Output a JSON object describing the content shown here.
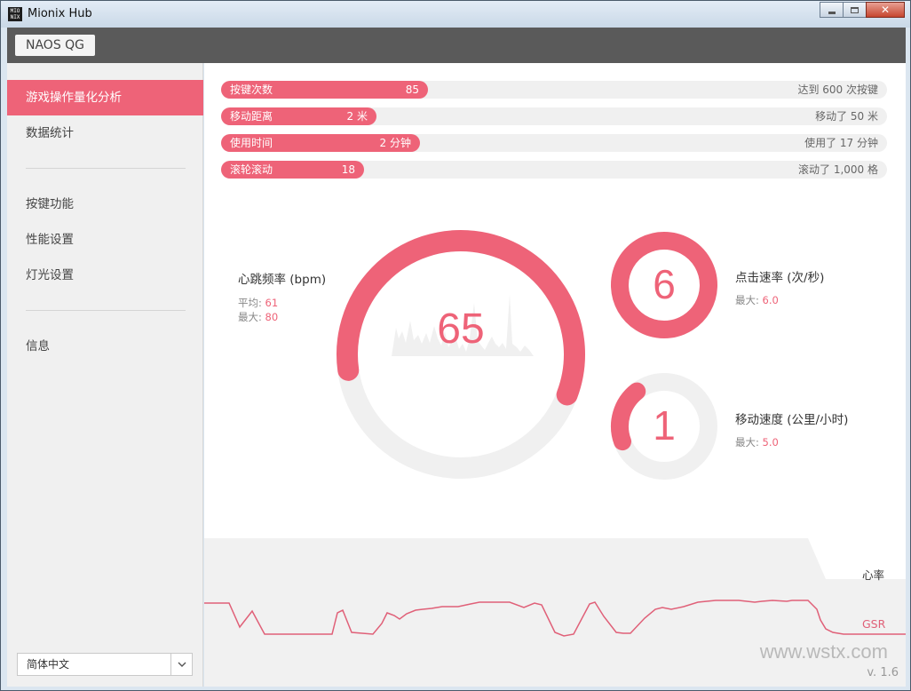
{
  "window": {
    "title": "Mionix Hub",
    "icon_text": "MIO NIX"
  },
  "header": {
    "device_tab": "NAOS QG"
  },
  "sidebar": {
    "items": [
      {
        "label": "游戏操作量化分析",
        "active": true
      },
      {
        "label": "数据统计"
      },
      {
        "label": "按键功能"
      },
      {
        "label": "性能设置"
      },
      {
        "label": "灯光设置"
      },
      {
        "label": "信息"
      }
    ],
    "language": "简体中文"
  },
  "stats": [
    {
      "label": "按键次数",
      "value": "85",
      "goal": "达到 600 次按键",
      "progress": 0.31
    },
    {
      "label": "移动距离",
      "value": "2 米",
      "goal": "移动了 50 米",
      "progress": 0.233
    },
    {
      "label": "使用时间",
      "value": "2 分钟",
      "goal": "使用了 17 分钟",
      "progress": 0.299
    },
    {
      "label": "滚轮滚动",
      "value": "18",
      "goal": "滚动了 1,000 格",
      "progress": 0.215
    }
  ],
  "heart_rate": {
    "title": "心跳频率 (bpm)",
    "avg_label": "平均:",
    "avg": "61",
    "max_label": "最大:",
    "max": "80",
    "value": "65",
    "progress": 0.58
  },
  "click_rate": {
    "title": "点击速率 (次/秒)",
    "max_label": "最大:",
    "max": "6.0",
    "value": "6",
    "progress": 1.0
  },
  "move_speed": {
    "title": "移动速度 (公里/小时)",
    "max_label": "最大:",
    "max": "5.0",
    "value": "1",
    "progress": 0.2
  },
  "graph": {
    "heart_label": "心率",
    "gsr_label": "GSR"
  },
  "footer": {
    "version": "v. 1.6",
    "watermark": "www.wstx.com"
  },
  "colors": {
    "accent": "#ee6378",
    "track": "#f0f0f0"
  }
}
